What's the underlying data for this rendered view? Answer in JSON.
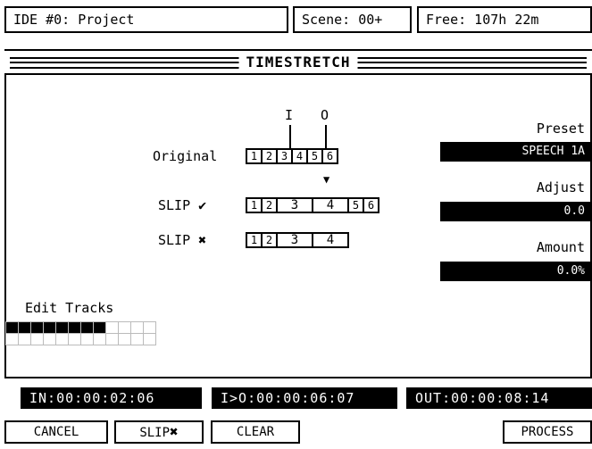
{
  "header": {
    "project": "IDE #0: Project",
    "scene": "Scene: 00+",
    "free": "Free: 107h 22m"
  },
  "banner": {
    "title": "TIMESTRETCH"
  },
  "diagram": {
    "in_marker": "I",
    "out_marker": "O",
    "original_label": "Original",
    "slip_on_label": "SLIP ✔",
    "slip_off_label": "SLIP ✖",
    "original_cells": [
      "1",
      "2",
      "3",
      "4",
      "5",
      "6"
    ],
    "slip_on_cells": [
      "1",
      "2",
      "3",
      "4",
      "5",
      "6"
    ],
    "slip_off_cells": [
      "1",
      "2",
      "3",
      "4"
    ],
    "arrow": "▼"
  },
  "settings": {
    "preset_label": "Preset",
    "preset_value": "SPEECH 1A",
    "adjust_label": "Adjust",
    "adjust_value": "0.0",
    "amount_label": "Amount",
    "amount_value": "0.0%"
  },
  "edit_tracks": {
    "label": "Edit Tracks",
    "selected_count": 8,
    "total": 24
  },
  "timecodes": {
    "in": "IN:00:00:02:06",
    "length": "I>O:00:00:06:07",
    "out": "OUT:00:00:08:14"
  },
  "buttons": {
    "cancel": "CANCEL",
    "slipx_text": "SLIP",
    "slipx_mark": "✖",
    "clear": "CLEAR",
    "process": "PROCESS"
  },
  "colors": {
    "background": "#ffffff",
    "foreground": "#000000"
  }
}
